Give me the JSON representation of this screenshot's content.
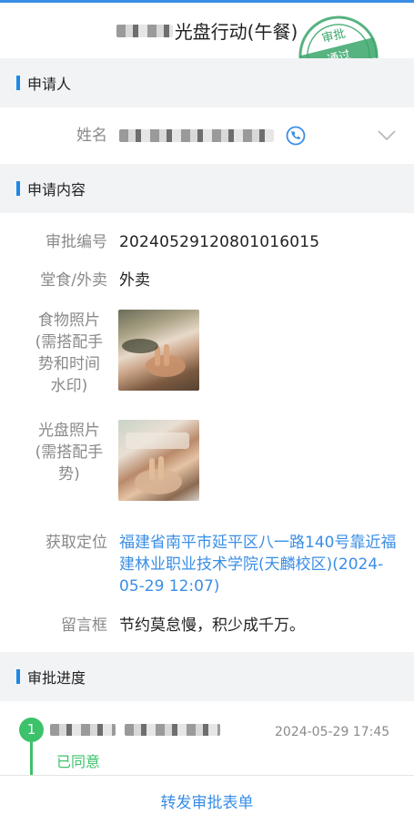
{
  "header": {
    "title": "光盘行动(午餐)"
  },
  "stamp": {
    "line1": "审批",
    "line2": "通过"
  },
  "applicant_section": {
    "title": "申请人"
  },
  "applicant": {
    "name_label": "姓名"
  },
  "content_section": {
    "title": "申请内容"
  },
  "fields": {
    "approval_no_label": "审批编号",
    "approval_no_value": "202405291208010160​15",
    "dine_label": "堂食/外卖",
    "dine_value": "外卖",
    "food_photo_label": "食物照片(需搭配手势和时间水印)",
    "clear_photo_label": "光盘照片(需搭配手势)",
    "location_label": "获取定位",
    "location_value": "福建省南平市延平区八一路140号靠近福建林业职业技术学院(天麟校区)(2024-05-29 12:07)",
    "message_label": "留言框",
    "message_value": "节约莫怠慢，积少成千万。"
  },
  "progress_section": {
    "title": "审批进度"
  },
  "progress": {
    "step_number": "1",
    "time": "2024-05-29 17:45",
    "status": "已同意"
  },
  "footer": {
    "forward_label": "转发审批表单"
  },
  "colors": {
    "accent": "#3a8ee6",
    "green": "#3cc26a",
    "section_bar": "#1e88e5"
  }
}
